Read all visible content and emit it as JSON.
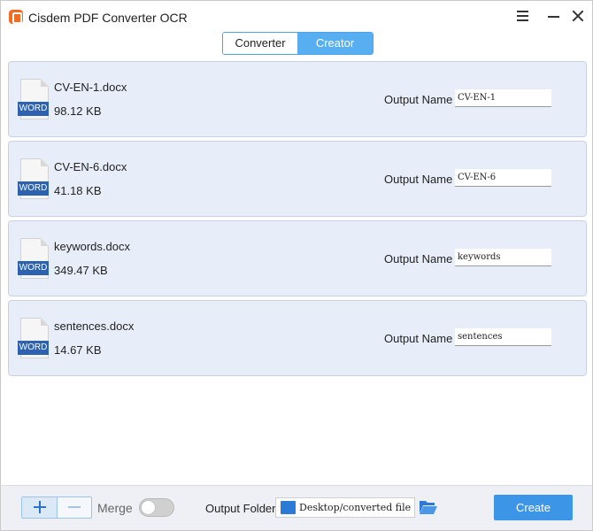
{
  "app": {
    "title": "Cisdem PDF Converter OCR",
    "accent_color": "#3d95e8",
    "logo_color": "#f26b21"
  },
  "window_controls": {
    "menu_icon": "hamburger-icon",
    "minimize_icon": "minimize-icon",
    "close_icon": "close-icon"
  },
  "tabs": [
    {
      "label": "Converter",
      "active": false
    },
    {
      "label": "Creator",
      "active": true
    }
  ],
  "files": [
    {
      "type_tag": "WORD",
      "name": "CV-EN-1.docx",
      "size": "98.12 KB",
      "output_label": "Output Name",
      "output_value": "CV-EN-1"
    },
    {
      "type_tag": "WORD",
      "name": "CV-EN-6.docx",
      "size": "41.18 KB",
      "output_label": "Output Name",
      "output_value": "CV-EN-6"
    },
    {
      "type_tag": "WORD",
      "name": "keywords.docx",
      "size": "349.47 KB",
      "output_label": "Output Name",
      "output_value": "keywords"
    },
    {
      "type_tag": "WORD",
      "name": "sentences.docx",
      "size": "14.67 KB",
      "output_label": "Output Name",
      "output_value": "sentences"
    }
  ],
  "bottom": {
    "add_icon": "plus-icon",
    "remove_icon": "minus-icon",
    "merge_label": "Merge",
    "merge_enabled": false,
    "output_folder_label": "Output Folder",
    "output_folder_path": "Desktop/converted file",
    "folder_icon": "folder-icon",
    "browse_icon": "open-folder-icon",
    "create_label": "Create"
  }
}
